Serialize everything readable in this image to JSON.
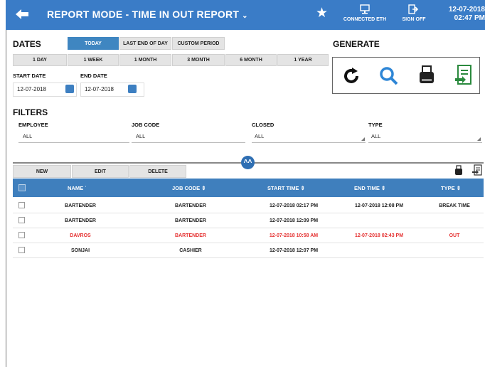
{
  "header": {
    "title": "REPORT MODE - TIME IN OUT REPORT",
    "connected_label": "CONNECTED ETH",
    "signoff_label": "SIGN OFF",
    "date": "12-07-2018",
    "time": "02:47 PM"
  },
  "dates": {
    "heading": "DATES",
    "presets": [
      "TODAY",
      "LAST END OF DAY",
      "CUSTOM PERIOD"
    ],
    "selected_preset": "TODAY",
    "ranges": [
      "1 DAY",
      "1 WEEK",
      "1 MONTH",
      "3 MONTH",
      "6 MONTH",
      "1 YEAR"
    ],
    "start_label": "START DATE",
    "start_value": "12-07-2018",
    "end_label": "END DATE",
    "end_value": "12-07-2018"
  },
  "generate": {
    "heading": "GENERATE",
    "icons": [
      "refresh-icon",
      "search-icon",
      "print-icon",
      "export-icon"
    ]
  },
  "filters": {
    "heading": "FILTERS",
    "employee_label": "EMPLOYEE",
    "employee_value": "ALL",
    "job_code_label": "JOB CODE",
    "job_code_value": "ALL",
    "closed_label": "CLOSED",
    "closed_value": "ALL",
    "type_label": "TYPE",
    "type_value": "ALL"
  },
  "actions": {
    "new_label": "NEW",
    "edit_label": "EDIT",
    "delete_label": "DELETE"
  },
  "table": {
    "columns": [
      "NAME",
      "JOB CODE",
      "START TIME",
      "END TIME",
      "TYPE"
    ],
    "rows": [
      {
        "name": "BARTENDER",
        "job_code": "BARTENDER",
        "start": "12-07-2018 02:17 PM",
        "end": "12-07-2018 12:08 PM",
        "type": "BREAK TIME",
        "highlight": false
      },
      {
        "name": "BARTENDER",
        "job_code": "BARTENDER",
        "start": "12-07-2018 12:09 PM",
        "end": "",
        "type": "",
        "highlight": false
      },
      {
        "name": "DAVROS",
        "job_code": "BARTENDER",
        "start": "12-07-2018 10:58 AM",
        "end": "12-07-2018 02:43 PM",
        "type": "OUT",
        "highlight": true
      },
      {
        "name": "SONJAI",
        "job_code": "CASHIER",
        "start": "12-07-2018 12:07 PM",
        "end": "",
        "type": "",
        "highlight": false
      }
    ]
  },
  "colors": {
    "header_bg": "#3a7cc7",
    "selected_btn": "#3f86c1",
    "highlight_text": "#e53030"
  }
}
